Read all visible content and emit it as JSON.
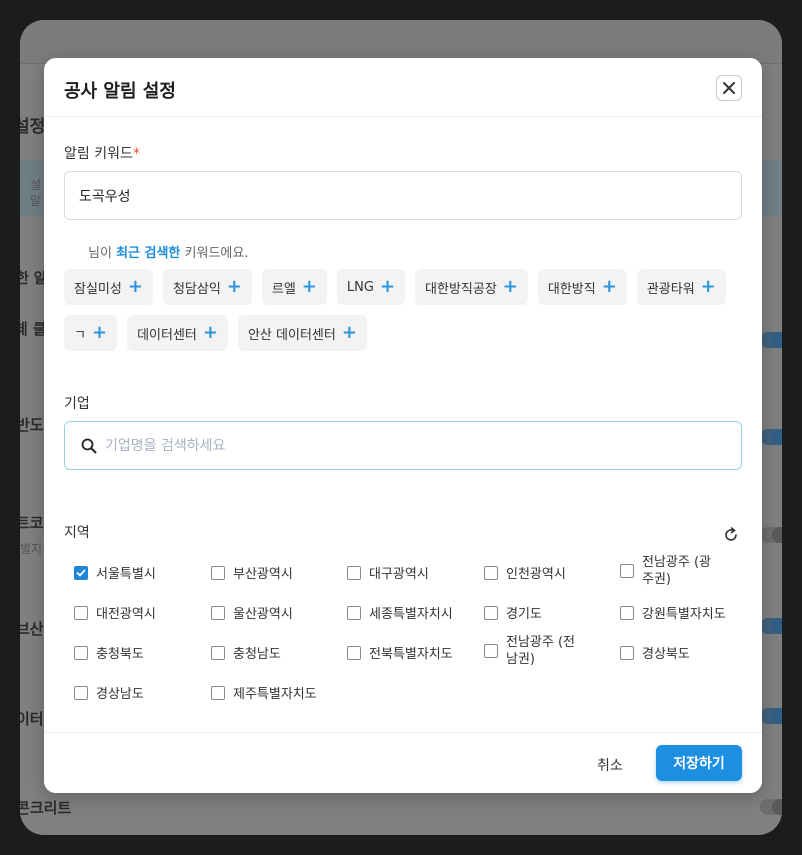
{
  "background": {
    "items": [
      "설정",
      "설",
      "알",
      "한 알",
      "체 클",
      "반도",
      "트코",
      "별지",
      "브산",
      "이터",
      "콘크리트"
    ]
  },
  "modal": {
    "title": "공사 알림 설정",
    "keyword_label": "알림 키워드",
    "required_mark": "*",
    "keyword_value": "도곡우성",
    "hint_prefix": "님이",
    "hint_highlight": "최근 검색한",
    "hint_suffix": "키워드에요.",
    "chips_row1": [
      "잠실미성",
      "청담삼익",
      "르엘",
      "LNG",
      "대한방직공장",
      "대한방직",
      "관광타워"
    ],
    "chips_row2": [
      "ㄱ",
      "데이터센터",
      "안산 데이터센터"
    ],
    "company_label": "기업",
    "company_placeholder": "기업명을 검색하세요",
    "region_label": "지역",
    "regions": [
      {
        "label": "서울특별시",
        "checked": true
      },
      {
        "label": "부산광역시",
        "checked": false
      },
      {
        "label": "대구광역시",
        "checked": false
      },
      {
        "label": "인천광역시",
        "checked": false
      },
      {
        "label": "전남광주 (광주권)",
        "checked": false
      },
      {
        "label": "대전광역시",
        "checked": false
      },
      {
        "label": "울산광역시",
        "checked": false
      },
      {
        "label": "세종특별자치시",
        "checked": false
      },
      {
        "label": "경기도",
        "checked": false
      },
      {
        "label": "강원특별자치도",
        "checked": false
      },
      {
        "label": "충청북도",
        "checked": false
      },
      {
        "label": "충청남도",
        "checked": false
      },
      {
        "label": "전북특별자치도",
        "checked": false
      },
      {
        "label": "전남광주 (전남권)",
        "checked": false
      },
      {
        "label": "경상북도",
        "checked": false
      },
      {
        "label": "경상남도",
        "checked": false
      },
      {
        "label": "제주특별자치도",
        "checked": false
      }
    ],
    "cancel_label": "취소",
    "save_label": "저장하기"
  },
  "colors": {
    "accent": "#1c8fe2",
    "highlight": "#1c8fdc",
    "required": "#e0502f"
  }
}
